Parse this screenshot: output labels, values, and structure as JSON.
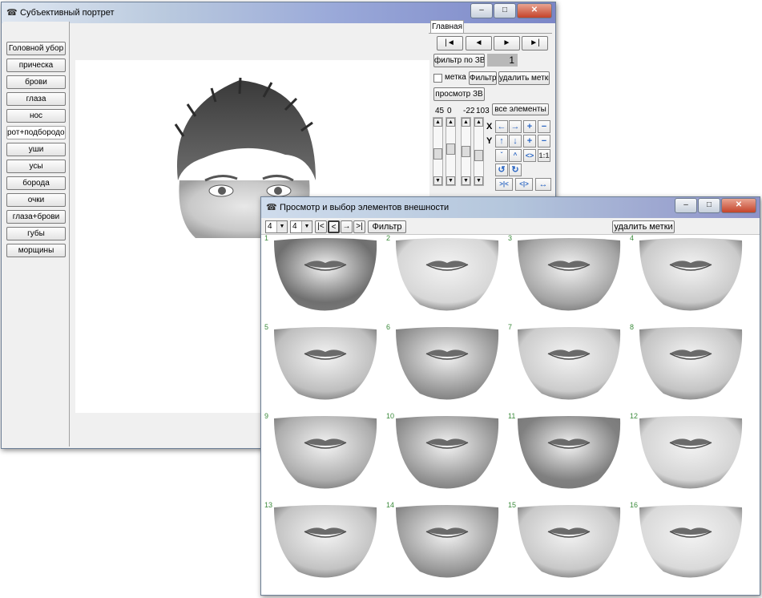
{
  "main_window": {
    "title": "Субъективный портрет",
    "tab": "Главная",
    "sidebar": [
      "Головной убор",
      "прическа",
      "брови",
      "глаза",
      "нос",
      "рот+подбородок",
      "уши",
      "усы",
      "борода",
      "очки",
      "глаза+брови",
      "губы",
      "морщины"
    ],
    "sidebar_selected": 5,
    "nav": {
      "first": "|◄",
      "prev": "◄",
      "next": "►",
      "last": "►|"
    },
    "filter_zv_label": "фильтр по ЗВ",
    "filter_zv_value": "1",
    "mark_checkbox_label": "метка",
    "filter_label": "Фильтр",
    "delete_marks_label": "удалить метки",
    "view_zv_label": "просмотр ЗВ",
    "all_elements_label": "все элементы",
    "values": [
      "45",
      "0",
      "-22",
      "103"
    ],
    "axis_x": "X",
    "axis_y": "Y",
    "ratio_label": "1:1"
  },
  "browser_window": {
    "title": "Просмотр и выбор элементов внешности",
    "cols_value": "4",
    "rows_value": "4",
    "nav": {
      "first": "|<",
      "prev": "<",
      "next": "→",
      "last": ">|"
    },
    "filter_label": "Фильтр",
    "delete_marks_label": "удалить метки",
    "cells": [
      "1",
      "2",
      "3",
      "4",
      "5",
      "6",
      "7",
      "8",
      "9",
      "10",
      "11",
      "12",
      "13",
      "14",
      "15",
      "16"
    ]
  },
  "colors": {
    "title_gradient_start": "#c9d6e6",
    "title_gradient_end": "#8fa9c8",
    "accent_arrow": "#2b66c2",
    "cell_number": "#3b8a3b"
  }
}
